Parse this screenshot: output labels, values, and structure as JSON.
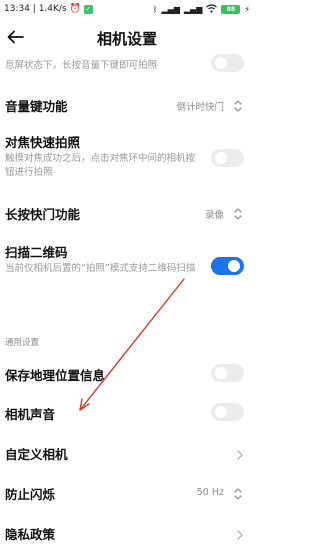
{
  "status": {
    "time_speed": "13:34 | 1.4K/s",
    "right_icons": [
      "bluetooth-icon",
      "signal-icon",
      "signal-icon",
      "wifi-icon"
    ],
    "battery": "88",
    "charging_icon": "lightning-icon"
  },
  "header": {
    "back_icon": "arrow-left-icon",
    "title": "相机设置"
  },
  "partial_row": {
    "desc": "息屏状态下，长按音量下键即可拍照",
    "toggle": false
  },
  "volume_key": {
    "label": "音量键功能",
    "value": "倒计时快门"
  },
  "focus_shoot": {
    "label": "对焦快速拍照",
    "desc": "触摸对焦成功之后，点击对焦环中间的相机按钮进行拍照",
    "toggle": false
  },
  "long_press": {
    "label": "长按快门功能",
    "value": "录像"
  },
  "qr_scan": {
    "label": "扫描二维码",
    "desc": "当前仅相机后置的“拍照”模式支持二维码扫描",
    "toggle": true
  },
  "general": {
    "section_title": "通用设置"
  },
  "location": {
    "label": "保存地理位置信息",
    "toggle": false
  },
  "camera_sound": {
    "label": "相机声音",
    "toggle": false
  },
  "custom_camera": {
    "label": "自定义相机"
  },
  "flicker": {
    "label": "防止闪烁",
    "value": "50 Hz"
  },
  "privacy": {
    "label": "隐私政策"
  },
  "colors": {
    "accent_blue": "#1b74e9",
    "annotation_red": "#d23b2c",
    "toggle_off": "#ececec"
  }
}
